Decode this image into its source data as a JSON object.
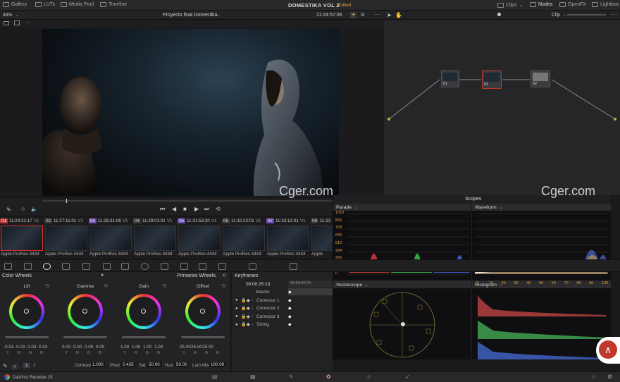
{
  "topbar": {
    "gallery": "Gallery",
    "luts": "LUTs",
    "media_pool": "Media Pool",
    "timeline": "Timeline",
    "project_title": "DOMESTIKA VOL 2",
    "project_status": "Edited",
    "clips": "Clips",
    "nodes": "Nodes",
    "openfx": "OpenFX",
    "lightbox": "Lightbox"
  },
  "viewer": {
    "zoom": "48%",
    "timeline_name": "Proyecto final Domestika",
    "timecode": "11:24:57:06",
    "node_mode": "Clip"
  },
  "nodes": [
    {
      "label": "01"
    },
    {
      "label": "03"
    },
    {
      "label": "02"
    }
  ],
  "thumbnails": [
    {
      "num": "01",
      "tc": "11:24:31:17",
      "track": "V1",
      "label": "Apple ProRes 4444",
      "style": "active"
    },
    {
      "num": "02",
      "tc": "11:27:11:01",
      "track": "V1",
      "label": "Apple ProRes 4444",
      "style": ""
    },
    {
      "num": "03",
      "tc": "11:28:31:08",
      "track": "V1",
      "label": "Apple ProRes 4444",
      "style": "purple"
    },
    {
      "num": "04",
      "tc": "11:29:01:01",
      "track": "V1",
      "label": "Apple ProRes 4444",
      "style": ""
    },
    {
      "num": "05",
      "tc": "11:31:53:20",
      "track": "V1",
      "label": "Apple ProRes 4444",
      "style": "purple"
    },
    {
      "num": "06",
      "tc": "11:32:23:01",
      "track": "V1",
      "label": "Apple ProRes 4444",
      "style": ""
    },
    {
      "num": "07",
      "tc": "11:33:12:01",
      "track": "V1",
      "label": "Apple ProRes 4444",
      "style": "purple"
    },
    {
      "num": "08",
      "tc": "11:33",
      "track": "",
      "label": "Apple",
      "style": ""
    }
  ],
  "color_wheels": {
    "title": "Color Wheels",
    "mode": "Primaries Wheels",
    "wheels": [
      {
        "name": "Lift",
        "values": [
          "-0.03",
          "-0.03",
          "-0.03",
          "-0.03"
        ]
      },
      {
        "name": "Gamma",
        "values": [
          "0.00",
          "0.00",
          "0.00",
          "0.00"
        ]
      },
      {
        "name": "Gain",
        "values": [
          "1.00",
          "1.00",
          "1.00",
          "1.00"
        ]
      },
      {
        "name": "Offset",
        "values": [
          "25.00",
          "25.00",
          "25.00",
          ""
        ]
      }
    ],
    "channels": [
      "Y",
      "R",
      "G",
      "B"
    ],
    "page_1": "1",
    "page_2": "2",
    "contrast_label": "Contrast",
    "contrast_value": "1.000",
    "pivot_label": "Pivot",
    "pivot_value": "0.435",
    "sat_label": "Sat",
    "sat_value": "50.00",
    "hue_label": "Hue",
    "hue_value": "50.00",
    "lummix_label": "Lum Mix",
    "lummix_value": "100.00"
  },
  "keyframes": {
    "title": "Keyframes",
    "timecode": "00:00:25:13",
    "ruler": "00:00:00:00",
    "rows": [
      "Master",
      "Corrector 1",
      "Corrector 2",
      "Corrector 3",
      "Sizing"
    ]
  },
  "scopes": {
    "title": "Scopes",
    "parade": "Parade",
    "waveform": "Waveform",
    "vectorscope": "Vectorscope",
    "histogram": "Histogram",
    "scale": [
      "1023",
      "896",
      "768",
      "640",
      "512",
      "384",
      "256",
      "128",
      "0"
    ],
    "histo_ticks": [
      "0",
      "10",
      "20",
      "30",
      "40",
      "50",
      "60",
      "70",
      "80",
      "90",
      "100"
    ]
  },
  "bottombar": {
    "app_name": "DaVinci Resolve 15"
  },
  "watermark": "Cger.com",
  "colors": {
    "accent": "#e2a13a",
    "selected_red": "#d33333",
    "node_outline": "#c0392b"
  }
}
